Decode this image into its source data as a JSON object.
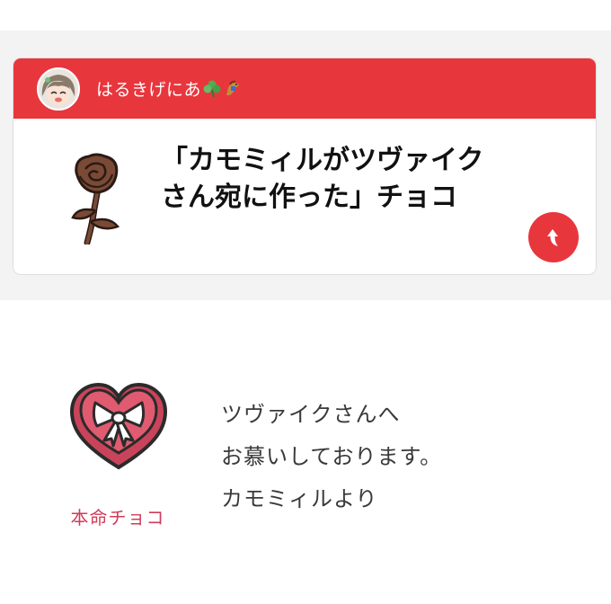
{
  "header": {
    "username": "はるきげにあ",
    "avatar_icon": "avatar-girl-icon",
    "badge_icons": [
      "clover-icon",
      "horse-icon"
    ],
    "color": "#e8363d"
  },
  "item": {
    "name": "「カモミィルがツヴァイクさん宛に作った」チョコ",
    "image_icon": "chocolate-rose-icon",
    "share_icon": "share-arrow-icon"
  },
  "choco": {
    "label": "本命チョコ",
    "icon": "heart-gift-box-icon",
    "label_color": "#d03c5a"
  },
  "message": {
    "lines": [
      "ツヴァイクさんへ",
      "お慕いしております。",
      "カモミィルより"
    ]
  }
}
